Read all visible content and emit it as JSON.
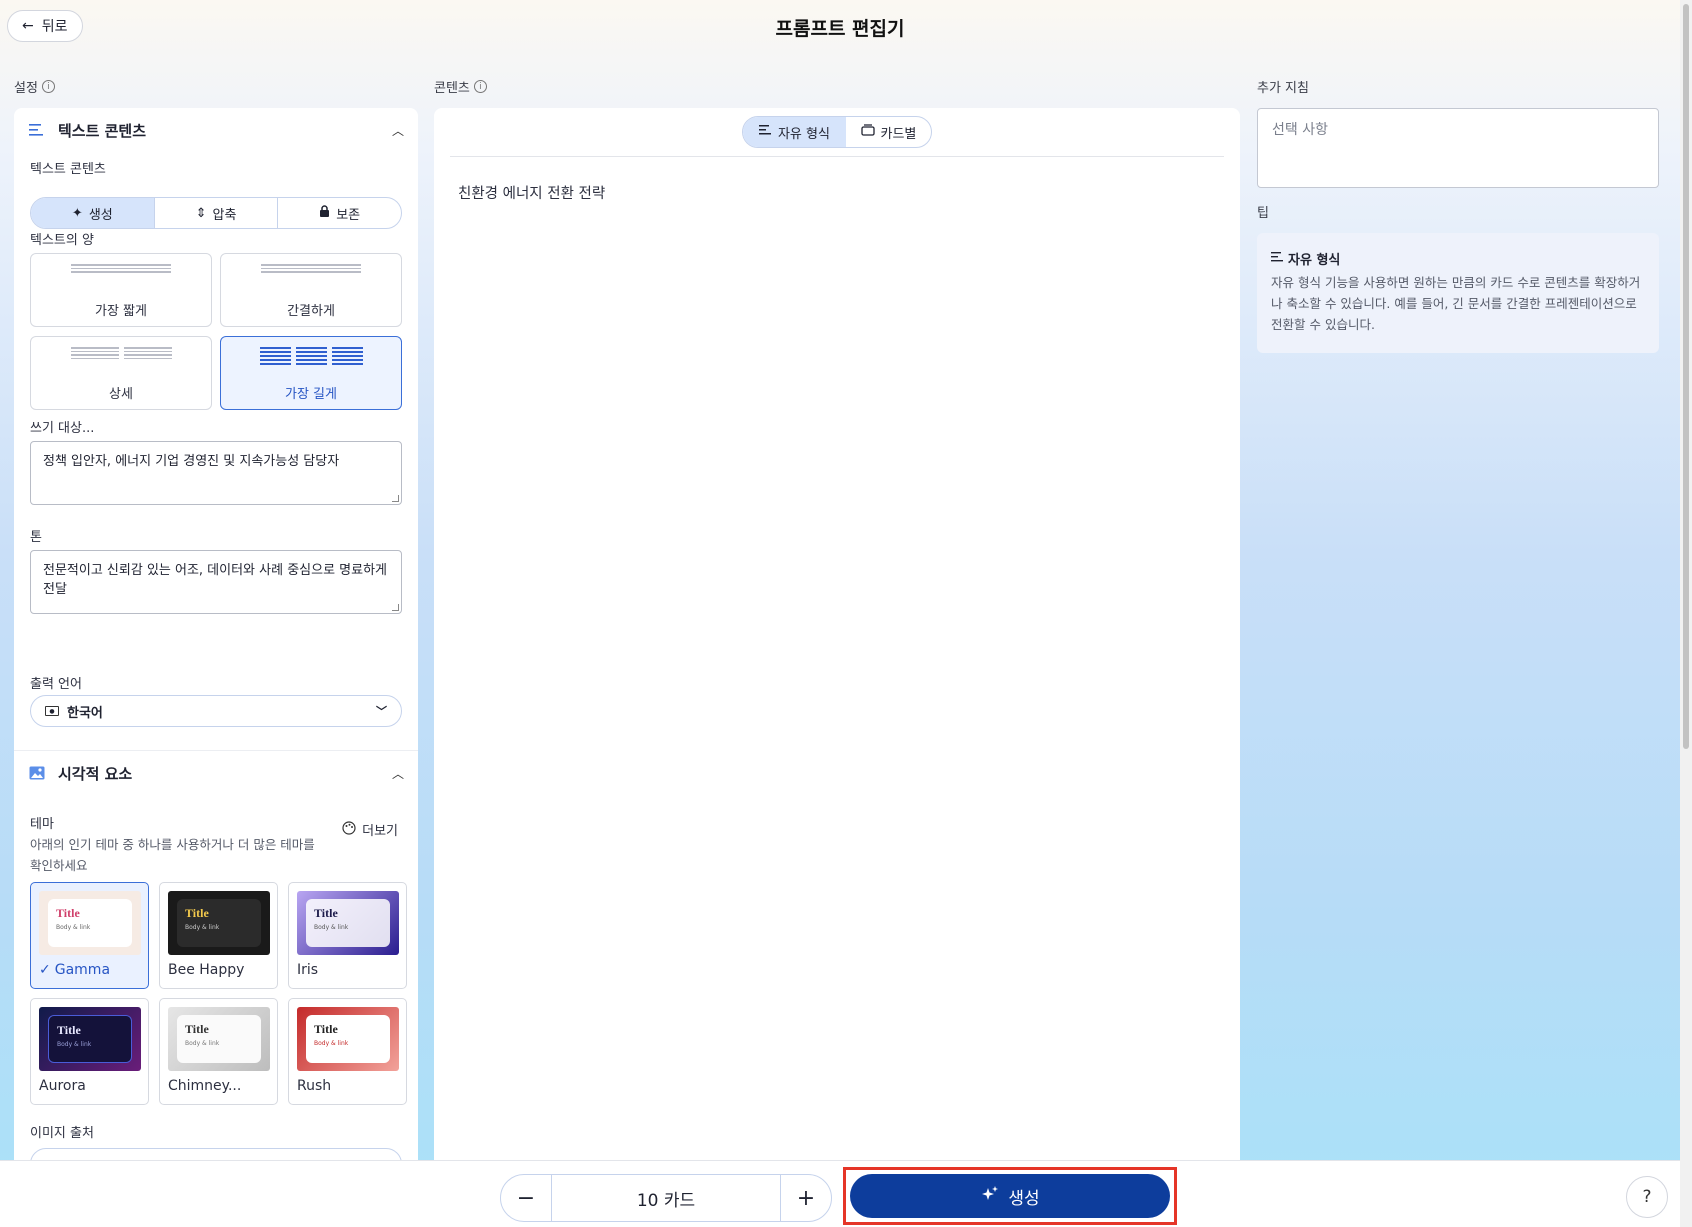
{
  "header": {
    "back_label": "뒤로",
    "title": "프롬프트 편집기"
  },
  "labels": {
    "settings": "설정",
    "content": "콘텐츠",
    "extra": "추가 지침",
    "tip": "팁"
  },
  "text_section": {
    "title": "텍스트 콘텐츠",
    "mode_label": "텍스트 콘텐츠",
    "modes": [
      {
        "label": "생성",
        "icon": "sparkle-icon",
        "active": true
      },
      {
        "label": "압축",
        "icon": "condense-icon",
        "active": false
      },
      {
        "label": "보존",
        "icon": "lock-icon",
        "active": false
      }
    ],
    "amount_label": "텍스트의 양",
    "amounts": [
      {
        "label": "가장 짧게",
        "selected": false
      },
      {
        "label": "간결하게",
        "selected": false
      },
      {
        "label": "상세",
        "selected": false
      },
      {
        "label": "가장 길게",
        "selected": true
      }
    ],
    "audience_label": "쓰기 대상...",
    "audience_value": "정책 입안자, 에너지 기업 경영진 및 지속가능성 담당자",
    "tone_label": "톤",
    "tone_value": "전문적이고 신뢰감 있는 어조, 데이터와 사례 중심으로 명료하게 전달",
    "language_label": "출력 언어",
    "language_value": "한국어"
  },
  "visual_section": {
    "title": "시각적 요소",
    "theme_label": "테마",
    "theme_desc": "아래의 인기 테마 중 하나를 사용하거나 더 많은 테마를 확인하세요",
    "more_label": "더보기",
    "themes": [
      {
        "name": "Gamma",
        "selected": true,
        "title": "Title",
        "body": "Body & link"
      },
      {
        "name": "Bee Happy",
        "selected": false,
        "title": "Title",
        "body": "Body & link"
      },
      {
        "name": "Iris",
        "selected": false,
        "title": "Title",
        "body": "Body & link"
      },
      {
        "name": "Aurora",
        "selected": false,
        "title": "Title",
        "body": "Body & link"
      },
      {
        "name": "Chimney...",
        "selected": false,
        "title": "Title",
        "body": "Body & link"
      },
      {
        "name": "Rush",
        "selected": false,
        "title": "Title",
        "body": "Body & link"
      }
    ],
    "image_source_label": "이미지 출처"
  },
  "content_panel": {
    "mode_freeform": "자유 형식",
    "mode_cards": "카드별",
    "text": "친환경 에너지 전환 전략"
  },
  "extra_panel": {
    "placeholder": "선택 사항",
    "tip_title": "자유 형식",
    "tip_body": "자유 형식 기능을 사용하면 원하는 만큼의 카드 수로 콘텐츠를 확장하거나 축소할 수 있습니다. 예를 들어, 긴 문서를 간결한 프레젠테이션으로 전환할 수 있습니다."
  },
  "bottom": {
    "count": "10 카드",
    "generate_label": "생성",
    "help_label": "?"
  },
  "colors": {
    "accent": "#3b6fd8",
    "primary_button": "#0d3d9c",
    "highlight_box": "#e53528"
  }
}
